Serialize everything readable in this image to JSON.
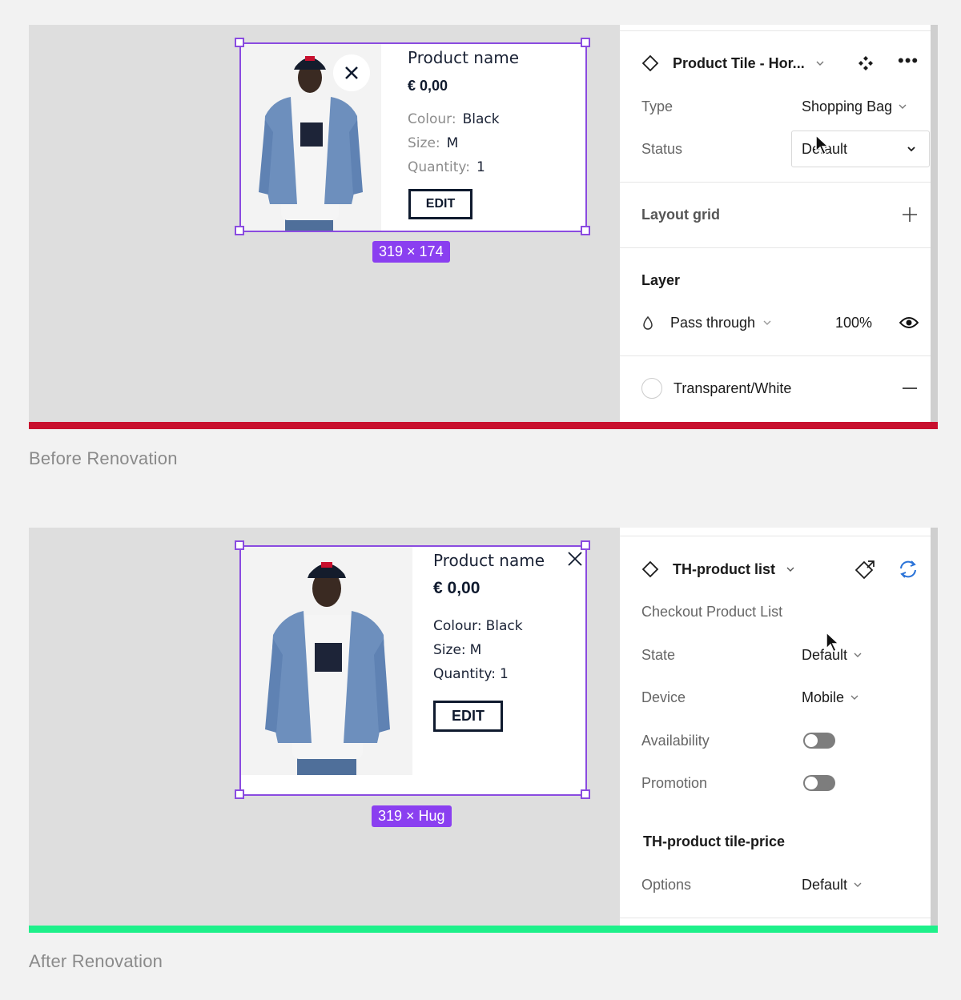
{
  "before": {
    "caption": "Before Renovation",
    "accent_color": "#c8102e",
    "tile": {
      "product_name": "Product name",
      "price": "€ 0,00",
      "colour_label": "Colour:",
      "colour_value": "Black",
      "size_label": "Size:",
      "size_value": "M",
      "quantity_label": "Quantity:",
      "quantity_value": "1",
      "edit_label": "EDIT",
      "size_badge": "319 × 174"
    },
    "panel": {
      "component_name": "Product Tile - Hor...",
      "type_label": "Type",
      "type_value": "Shopping Bag",
      "status_label": "Status",
      "status_value": "Default",
      "layout_grid_label": "Layout grid",
      "layer_label": "Layer",
      "blend_mode": "Pass through",
      "opacity": "100%",
      "fill_name": "Transparent/White"
    }
  },
  "after": {
    "caption": "After Renovation",
    "accent_color": "#1ef08a",
    "tile": {
      "product_name": "Product name",
      "price": "€ 0,00",
      "colour_label": "Colour:",
      "colour_value": "Black",
      "size_label": "Size:",
      "size_value": "M",
      "quantity_label": "Quantity:",
      "quantity_value": "1",
      "edit_label": "EDIT",
      "size_badge": "319 × Hug"
    },
    "panel": {
      "component_name": "TH-product list",
      "description": "Checkout Product List",
      "state_label": "State",
      "state_value": "Default",
      "device_label": "Device",
      "device_value": "Mobile",
      "availability_label": "Availability",
      "availability_on": false,
      "promotion_label": "Promotion",
      "promotion_on": false,
      "nested_component": "TH-product tile-price",
      "options_label": "Options",
      "options_value": "Default"
    }
  }
}
